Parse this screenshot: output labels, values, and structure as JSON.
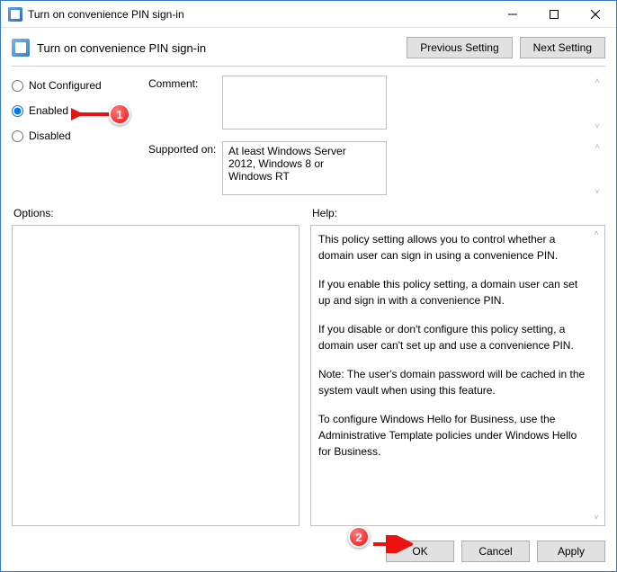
{
  "window": {
    "title": "Turn on convenience PIN sign-in"
  },
  "header": {
    "title": "Turn on convenience PIN sign-in",
    "previous_label": "Previous Setting",
    "next_label": "Next Setting"
  },
  "state": {
    "not_configured": "Not Configured",
    "enabled": "Enabled",
    "disabled": "Disabled",
    "selected": "enabled"
  },
  "fields": {
    "comment_label": "Comment:",
    "comment_value": "",
    "supported_label": "Supported on:",
    "supported_value": "At least Windows Server 2012, Windows 8 or Windows RT"
  },
  "sections": {
    "options_label": "Options:",
    "help_label": "Help:"
  },
  "help": {
    "p1": "This policy setting allows you to control whether a domain user can sign in using a convenience PIN.",
    "p2": "If you enable this policy setting, a domain user can set up and sign in with a convenience PIN.",
    "p3": "If you disable or don't configure this policy setting, a domain user can't set up and use a convenience PIN.",
    "p4": "Note: The user's domain password will be cached in the system vault when using this feature.",
    "p5": "To configure Windows Hello for Business, use the Administrative Template policies under Windows Hello for Business."
  },
  "footer": {
    "ok": "OK",
    "cancel": "Cancel",
    "apply": "Apply"
  },
  "annotations": {
    "badge1": "1",
    "badge2": "2"
  }
}
